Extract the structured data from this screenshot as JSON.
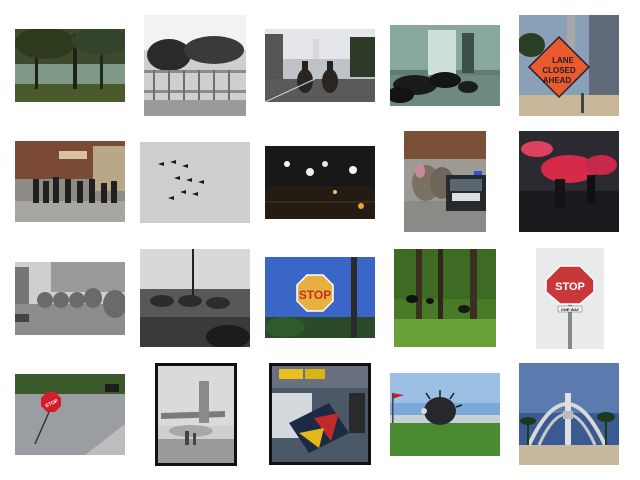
{
  "gallery": {
    "images": [
      {
        "id": "t01",
        "subject": "park trees and pond"
      },
      {
        "id": "t02",
        "subject": "crowd behind barricades"
      },
      {
        "id": "t03",
        "subject": "mounted police on street"
      },
      {
        "id": "t04",
        "subject": "umbrellas on office floor"
      },
      {
        "id": "t05",
        "subject": "road sign",
        "sign_text": [
          "LANE",
          "CLOSED",
          "AHEAD"
        ]
      },
      {
        "id": "t06",
        "subject": "crowd on sidewalk"
      },
      {
        "id": "t07",
        "subject": "jets flying in formation"
      },
      {
        "id": "t08",
        "subject": "street at night with lights"
      },
      {
        "id": "t09",
        "subject": "elephants beside police car"
      },
      {
        "id": "t10",
        "subject": "pink umbrellas in the rain"
      },
      {
        "id": "t11",
        "subject": "elephant parade on wet street"
      },
      {
        "id": "t12",
        "subject": "parade seen from car window"
      },
      {
        "id": "t13",
        "subject": "stop sign under blue sky",
        "sign_text": [
          "STOP"
        ]
      },
      {
        "id": "t14",
        "subject": "animals in green forest"
      },
      {
        "id": "t15",
        "subject": "stop sign with street name",
        "sign_text": [
          "STOP",
          "ONE WAY"
        ]
      },
      {
        "id": "t16",
        "subject": "tilted stop sign on road",
        "sign_text": [
          "STOP"
        ]
      },
      {
        "id": "t17",
        "subject": "airplane on tarmac"
      },
      {
        "id": "t18",
        "subject": "umbrellas with taxi"
      },
      {
        "id": "t19",
        "subject": "giant inflatable hedgehog"
      },
      {
        "id": "t20",
        "subject": "monument arch with palms"
      }
    ]
  }
}
